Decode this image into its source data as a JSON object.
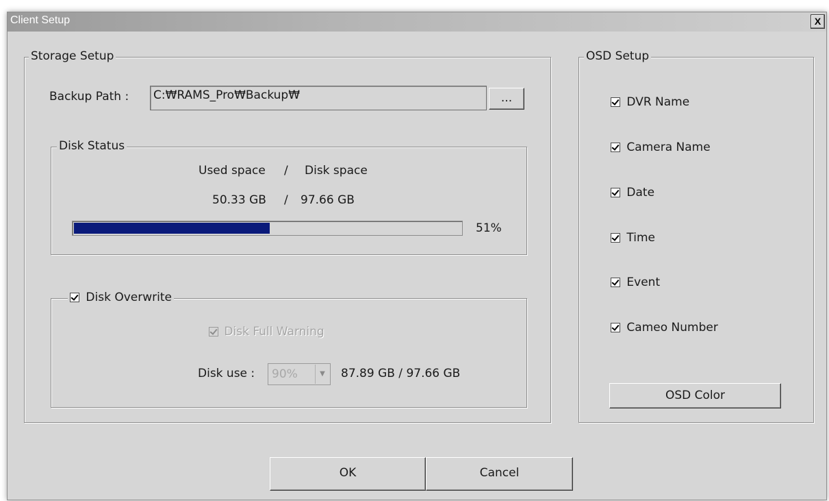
{
  "window": {
    "title": "Client Setup",
    "close_label": "X"
  },
  "storage": {
    "legend": "Storage Setup",
    "backup_path_label": "Backup Path :",
    "backup_path_value": "C:₩RAMS_Pro₩Backup₩",
    "browse_label": "...",
    "disk_status": {
      "legend": "Disk Status",
      "header_used": "Used space",
      "header_sep": "/",
      "header_disk": "Disk space",
      "used": "50.33 GB",
      "sep": "/",
      "total": "97.66 GB",
      "percent_label": "51%",
      "percent_value": 0.51
    },
    "overwrite": {
      "legend": "Disk Overwrite",
      "checked": true,
      "full_warning_label": "Disk Full Warning",
      "full_warning_checked": true,
      "disk_use_label": "Disk use :",
      "disk_use_value": "90%",
      "disk_use_info": "87.89 GB / 97.66 GB"
    }
  },
  "osd": {
    "legend": "OSD Setup",
    "items": [
      {
        "label": "DVR Name",
        "checked": true
      },
      {
        "label": "Camera Name",
        "checked": true
      },
      {
        "label": "Date",
        "checked": true
      },
      {
        "label": "Time",
        "checked": true
      },
      {
        "label": "Event",
        "checked": true
      },
      {
        "label": "Cameo Number",
        "checked": true
      }
    ],
    "color_button": "OSD Color"
  },
  "footer": {
    "ok_label": "OK",
    "cancel_label": "Cancel"
  }
}
